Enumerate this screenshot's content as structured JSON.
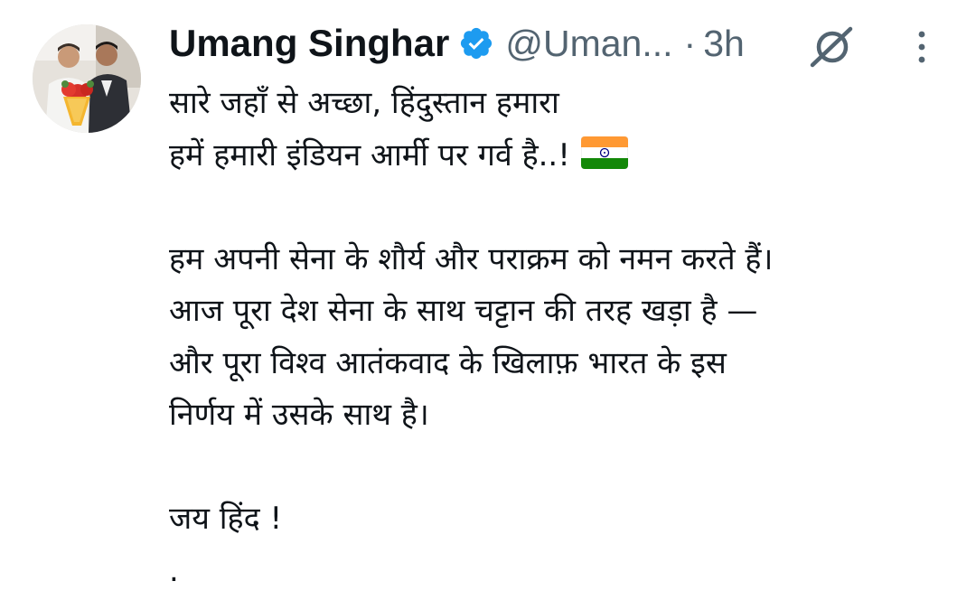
{
  "author": {
    "display_name": "Umang Singhar",
    "handle": "@Uman...",
    "separator": "·",
    "timestamp": "3h",
    "verified": true,
    "verified_color": "#1d9bf0"
  },
  "tweet": {
    "lines": [
      "सारे जहाँ से अच्छा, हिंदुस्तान हमारा",
      "हमें हमारी इंडियन आर्मी पर गर्व है..!",
      "",
      "हम अपनी सेना के शौर्य और पराक्रम को नमन करते हैं।",
      "आज पूरा देश सेना के साथ चट्टान की तरह खड़ा है —",
      "और पूरा विश्व आतंकवाद के खिलाफ़ भारत के इस",
      "निर्णय में उसके साथ है।",
      "",
      "जय हिंद !",
      "."
    ],
    "emoji": "india-flag"
  },
  "icons": {
    "avatar": "profile-photo",
    "verified": "verified-badge-icon",
    "grok": "grok-icon",
    "more": "more-vertical-icon"
  },
  "colors": {
    "text": "#0f1419",
    "secondary": "#536471",
    "background": "#ffffff"
  }
}
